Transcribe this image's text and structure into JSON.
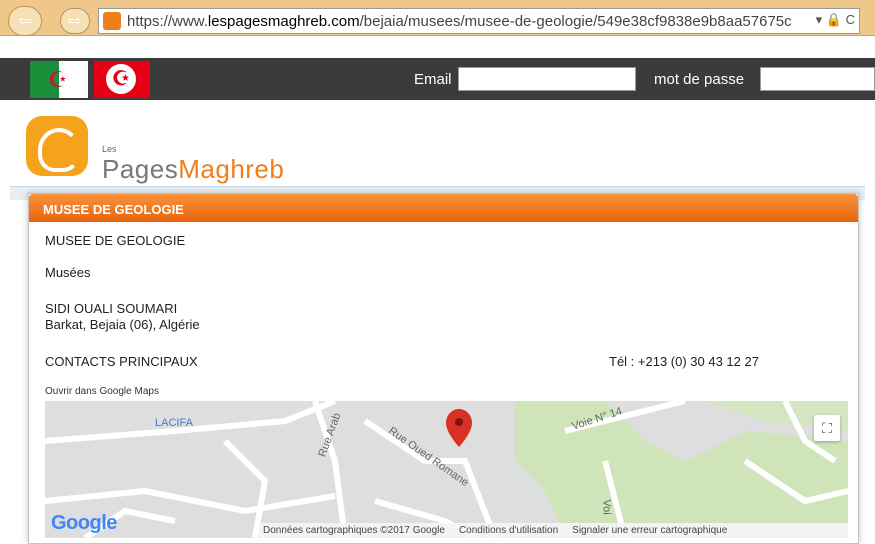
{
  "browser": {
    "url_prefix": "https://www.",
    "url_domain": "lespagesmaghreb.com",
    "url_path": "/bejaia/musees/musee-de-geologie/549e38cf9838e9b8aa57675c",
    "url_tools": "▾ 🔒 C"
  },
  "header": {
    "email_label": "Email",
    "password_label": "mot de passe"
  },
  "logo": {
    "les": "Les",
    "pages": "Pages",
    "maghreb": "Maghreb"
  },
  "panel": {
    "title": "MUSEE DE GEOLOGIE",
    "name": "MUSEE DE GEOLOGIE",
    "category": "Musées",
    "address_line1": "SIDI OUALI SOUMARI",
    "address_line2": "Barkat, Bejaia (06), Algérie",
    "contacts_heading": "CONTACTS PRINCIPAUX",
    "phone": "Tél : +213 (0) 30 43 12 27",
    "open_in_maps": "Ouvrir dans Google Maps"
  },
  "map": {
    "labels": {
      "lacifa": "LACIFA",
      "rue_arab": "Rue Arab",
      "rue_oued_romane": "Rue Oued Romane",
      "voie_n": "Voie N° 14",
      "voi": "Voi"
    },
    "google": "Google",
    "footer_data": "Données cartographiques ©2017 Google",
    "footer_terms": "Conditions d'utilisation",
    "footer_report": "Signaler une erreur cartographique"
  },
  "colors": {
    "accent": "#f07f1a",
    "header_bg": "#3b3b3b",
    "pin": "#d93025"
  }
}
